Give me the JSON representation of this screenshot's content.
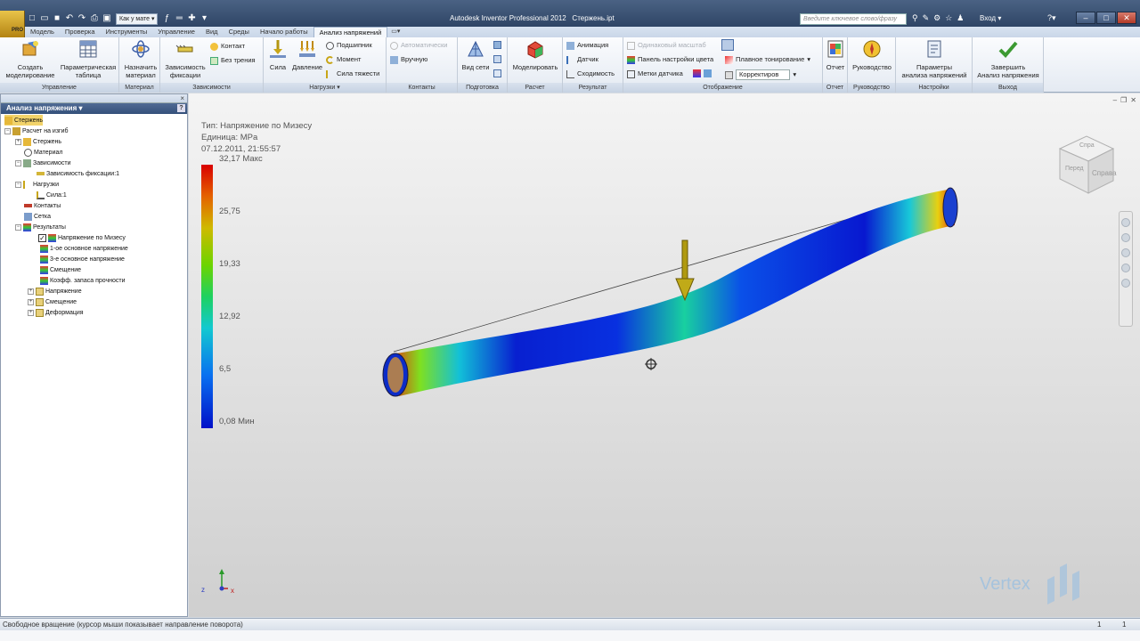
{
  "window": {
    "title": "Autodesk Inventor Professional 2012",
    "document": "Стержень.ipt",
    "search_placeholder": "Введите ключевое слово/фразу",
    "signin": "Вход",
    "app_button_label": "PRO"
  },
  "qat": {
    "appearance": "Как у мате"
  },
  "tabs": [
    {
      "label": "Модель"
    },
    {
      "label": "Проверка"
    },
    {
      "label": "Инструменты"
    },
    {
      "label": "Управление"
    },
    {
      "label": "Вид"
    },
    {
      "label": "Среды"
    },
    {
      "label": "Начало работы"
    },
    {
      "label": "Анализ напряжений",
      "active": true
    }
  ],
  "ribbon": {
    "panels": [
      {
        "title": "Управление"
      },
      {
        "title": "Материал"
      },
      {
        "title": "Зависимости"
      },
      {
        "title": "Нагрузки"
      },
      {
        "title": "Контакты"
      },
      {
        "title": "Подготовка"
      },
      {
        "title": "Расчет"
      },
      {
        "title": "Результат"
      },
      {
        "title": "Отображение"
      },
      {
        "title": "Отчет"
      },
      {
        "title": "Руководство"
      },
      {
        "title": "Настройки"
      },
      {
        "title": "Выход"
      }
    ],
    "create_sim_1": "Создать",
    "create_sim_2": "моделирование",
    "param_table_1": "Параметрическая",
    "param_table_2": "таблица",
    "assign_mat_1": "Назначить",
    "assign_mat_2": "материал",
    "fixed_1": "Зависимость",
    "fixed_2": "фиксации",
    "contact": "Контакт",
    "frictionless": "Без трения",
    "force": "Сила",
    "pressure": "Давление",
    "bearing": "Подшипник",
    "moment": "Момент",
    "gravity": "Сила тяжести",
    "automatic": "Автоматически",
    "manual": "Вручную",
    "mesh_view": "Вид сети",
    "simulate": "Моделировать",
    "animation": "Анимация",
    "probe": "Датчик",
    "convergence": "Сходимость",
    "same_scale": "Одинаковый масштаб",
    "color_bar": "Панель настройки цвета",
    "probe_labels": "Метки датчика",
    "smooth_shading": "Плавное тонирование",
    "adjust": "Корректиров",
    "report": "Отчет",
    "guide": "Руководство",
    "settings_1": "Параметры",
    "settings_2": "анализа напряжений",
    "finish_1": "Завершить",
    "finish_2": "Анализ напряжения"
  },
  "browser": {
    "header": "Анализ напряжения",
    "help": "?",
    "nodes": [
      {
        "label": "Стержень"
      },
      {
        "label": "Расчет на изгиб"
      },
      {
        "label": "Стержень"
      },
      {
        "label": "Материал"
      },
      {
        "label": "Зависимости"
      },
      {
        "label": "Зависимость фиксации:1"
      },
      {
        "label": "Нагрузки"
      },
      {
        "label": "Сила:1"
      },
      {
        "label": "Контакты"
      },
      {
        "label": "Сетка"
      },
      {
        "label": "Результаты"
      },
      {
        "label": "Напряжение по Мизесу"
      },
      {
        "label": "1-ое основное напряжение"
      },
      {
        "label": "3-е основное напряжение"
      },
      {
        "label": "Смещение"
      },
      {
        "label": "Коэфф. запаса прочности"
      },
      {
        "label": "Напряжение"
      },
      {
        "label": "Смещение"
      },
      {
        "label": "Деформация"
      }
    ]
  },
  "viewport": {
    "type_line": "Тип: Напряжение по Мизесу",
    "unit_line": "Единица: MPa",
    "date_line": "07.12.2011, 21:55:57",
    "legend": [
      "32,17 Макс",
      "25,75",
      "19,33",
      "12,92",
      "6,5",
      "0,08 Мин"
    ],
    "viewcube_face1": "Спра",
    "viewcube_face2": "Перед",
    "viewcube_face3": "Справа",
    "watermark": "Vertex",
    "axis_x": "x",
    "axis_z": "z"
  },
  "status": {
    "message": "Свободное вращение (курсор мыши показывает направление поворота)",
    "n1": "1",
    "n2": "1"
  }
}
